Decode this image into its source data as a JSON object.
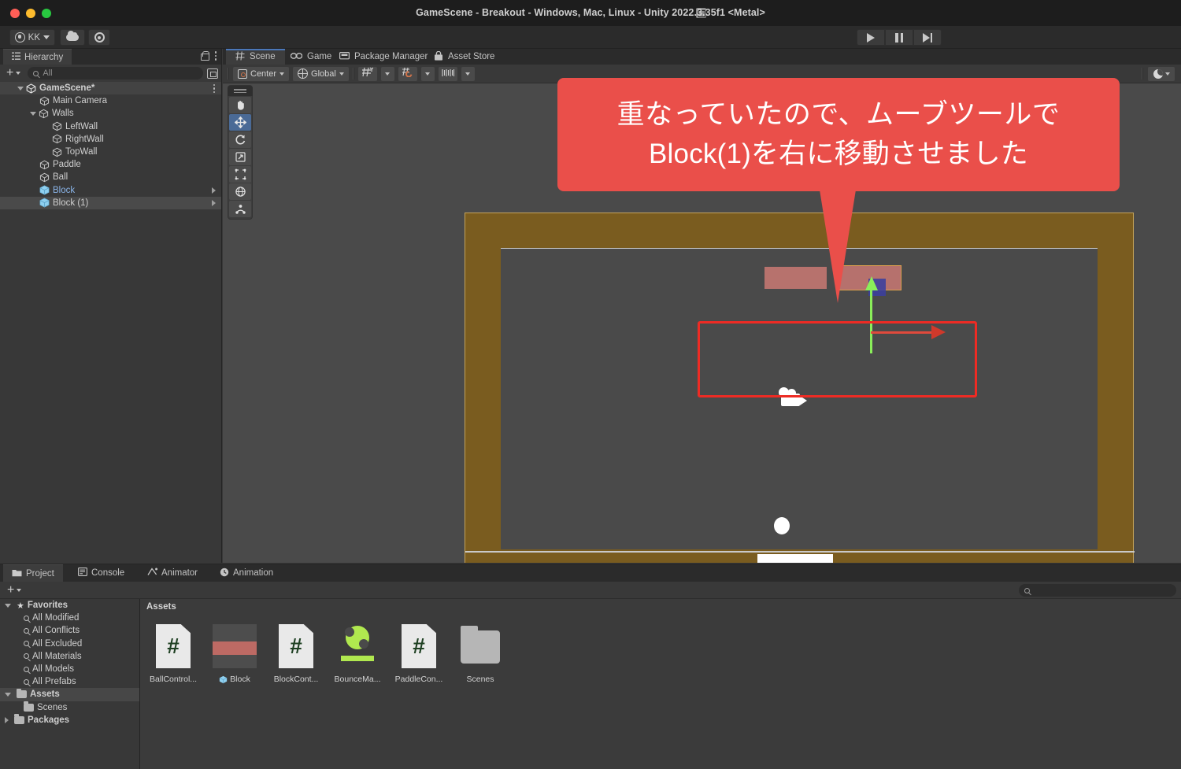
{
  "window": {
    "title": "GameScene - Breakout - Windows, Mac, Linux - Unity 2022.3.35f1 <Metal>",
    "app_icon": "unity-icon"
  },
  "main_toolbar": {
    "account_label": "KK",
    "account_icon": "account-icon",
    "cloud_icon": "cloud-icon",
    "settings_icon": "gear-icon",
    "play_icon": "play-icon",
    "pause_icon": "pause-icon",
    "step_icon": "step-icon"
  },
  "hierarchy": {
    "tab_label": "Hierarchy",
    "tab_icon": "hierarchy-icon",
    "lock_icon": "lock-icon",
    "menu_icon": "kebab-menu-icon",
    "add_label": "+",
    "search_placeholder": "All",
    "search_value": "",
    "search_icon": "search-icon",
    "visibility_icon": "scene-visibility-icon",
    "items": [
      {
        "label": "GameScene*",
        "depth": 0,
        "icon": "unity-scene-icon",
        "expand": "down",
        "selected": false,
        "prefab": false,
        "root": true,
        "chevron": false,
        "kebab": true
      },
      {
        "label": "Main Camera",
        "depth": 1,
        "icon": "gameobject-icon",
        "expand": "none",
        "selected": false,
        "prefab": false,
        "root": false,
        "chevron": false,
        "kebab": false
      },
      {
        "label": "Walls",
        "depth": 1,
        "icon": "gameobject-icon",
        "expand": "down",
        "selected": false,
        "prefab": false,
        "root": false,
        "chevron": false,
        "kebab": false
      },
      {
        "label": "LeftWall",
        "depth": 2,
        "icon": "gameobject-icon",
        "expand": "none",
        "selected": false,
        "prefab": false,
        "root": false,
        "chevron": false,
        "kebab": false
      },
      {
        "label": "RightWall",
        "depth": 2,
        "icon": "gameobject-icon",
        "expand": "none",
        "selected": false,
        "prefab": false,
        "root": false,
        "chevron": false,
        "kebab": false
      },
      {
        "label": "TopWall",
        "depth": 2,
        "icon": "gameobject-icon",
        "expand": "none",
        "selected": false,
        "prefab": false,
        "root": false,
        "chevron": false,
        "kebab": false
      },
      {
        "label": "Paddle",
        "depth": 1,
        "icon": "gameobject-icon",
        "expand": "none",
        "selected": false,
        "prefab": false,
        "root": false,
        "chevron": false,
        "kebab": false
      },
      {
        "label": "Ball",
        "depth": 1,
        "icon": "gameobject-icon",
        "expand": "none",
        "selected": false,
        "prefab": false,
        "root": false,
        "chevron": false,
        "kebab": false
      },
      {
        "label": "Block",
        "depth": 1,
        "icon": "prefab-icon",
        "expand": "none",
        "selected": false,
        "prefab": true,
        "root": false,
        "chevron": true,
        "kebab": false
      },
      {
        "label": "Block (1)",
        "depth": 1,
        "icon": "prefab-icon",
        "expand": "none",
        "selected": true,
        "prefab": false,
        "root": false,
        "chevron": true,
        "kebab": false
      }
    ]
  },
  "scene_view": {
    "tabs": [
      {
        "label": "Scene",
        "icon": "scene-grid-icon",
        "active": true
      },
      {
        "label": "Game",
        "icon": "game-controller-icon",
        "active": false
      },
      {
        "label": "Package Manager",
        "icon": "package-icon",
        "active": false
      },
      {
        "label": "Asset Store",
        "icon": "store-bag-icon",
        "active": false
      }
    ],
    "toolbar": {
      "pivot_label": "Center",
      "pivot_icon": "pivot-center-icon",
      "handle_label": "Global",
      "handle_icon": "globe-icon",
      "grid_icon": "grid-axis-icon",
      "snap_icon": "magnet-snap-icon",
      "scale_icon": "scale-slider-icon",
      "shading_icon": "shading-mode-icon"
    },
    "tools": [
      {
        "name": "hand-tool",
        "glyph": "✋",
        "active": false
      },
      {
        "name": "move-tool",
        "glyph": "✥",
        "active": true
      },
      {
        "name": "rotate-tool",
        "glyph": "↻",
        "active": false
      },
      {
        "name": "scale-tool",
        "glyph": "⤡",
        "active": false
      },
      {
        "name": "rect-tool",
        "glyph": "⬚",
        "active": false
      },
      {
        "name": "transform-tool",
        "glyph": "⊕",
        "active": false
      },
      {
        "name": "custom-tool",
        "glyph": "⌵",
        "active": false
      }
    ],
    "gizmo": {
      "y_axis_color": "#8aee5a",
      "x_axis_color": "#e04a3c",
      "z_axis_color": "#3b3f9e"
    },
    "objects": {
      "block_color": "#c07570",
      "selected_outline_color": "#e9a84e",
      "wall_color": "#7a5c1f",
      "ball_color": "#ffffff",
      "paddle_color": "#ffffff",
      "camera_gizmo": "camera-gizmo-icon"
    },
    "selection_box_color": "#ee2b24"
  },
  "callout": {
    "line1": "重なっていたので、ムーブツールで",
    "line2": "Block(1)を右に移動させました",
    "background_color": "#ea4f4a",
    "text_color": "#ffffff"
  },
  "project": {
    "tabs": [
      {
        "label": "Project",
        "icon": "folder-icon",
        "active": true
      },
      {
        "label": "Console",
        "icon": "console-icon",
        "active": false
      },
      {
        "label": "Animator",
        "icon": "animator-icon",
        "active": false
      },
      {
        "label": "Animation",
        "icon": "animation-clock-icon",
        "active": false
      }
    ],
    "add_label": "+",
    "search_placeholder": "",
    "search_value": "",
    "search_icon": "search-icon",
    "tree": [
      {
        "label": "Favorites",
        "depth": 0,
        "icon": "star-icon",
        "expand": "down",
        "bold": true,
        "highlight": false
      },
      {
        "label": "All Modified",
        "depth": 1,
        "icon": "search-icon",
        "expand": "none",
        "bold": false,
        "highlight": false
      },
      {
        "label": "All Conflicts",
        "depth": 1,
        "icon": "search-icon",
        "expand": "none",
        "bold": false,
        "highlight": false
      },
      {
        "label": "All Excluded",
        "depth": 1,
        "icon": "search-icon",
        "expand": "none",
        "bold": false,
        "highlight": false
      },
      {
        "label": "All Materials",
        "depth": 1,
        "icon": "search-icon",
        "expand": "none",
        "bold": false,
        "highlight": false
      },
      {
        "label": "All Models",
        "depth": 1,
        "icon": "search-icon",
        "expand": "none",
        "bold": false,
        "highlight": false
      },
      {
        "label": "All Prefabs",
        "depth": 1,
        "icon": "search-icon",
        "expand": "none",
        "bold": false,
        "highlight": false
      },
      {
        "label": "Assets",
        "depth": 0,
        "icon": "folder-icon",
        "expand": "down",
        "bold": true,
        "highlight": true
      },
      {
        "label": "Scenes",
        "depth": 1,
        "icon": "folder-icon",
        "expand": "none",
        "bold": false,
        "highlight": false
      },
      {
        "label": "Packages",
        "depth": 0,
        "icon": "folder-icon",
        "expand": "right",
        "bold": true,
        "highlight": false
      }
    ],
    "breadcrumb": "Assets",
    "assets": [
      {
        "label": "BallControl...",
        "kind": "csharp-script"
      },
      {
        "label": "Block",
        "kind": "prefab"
      },
      {
        "label": "BlockCont...",
        "kind": "csharp-script"
      },
      {
        "label": "BounceMa...",
        "kind": "physics-material"
      },
      {
        "label": "PaddleCon...",
        "kind": "csharp-script"
      },
      {
        "label": "Scenes",
        "kind": "folder"
      }
    ]
  }
}
